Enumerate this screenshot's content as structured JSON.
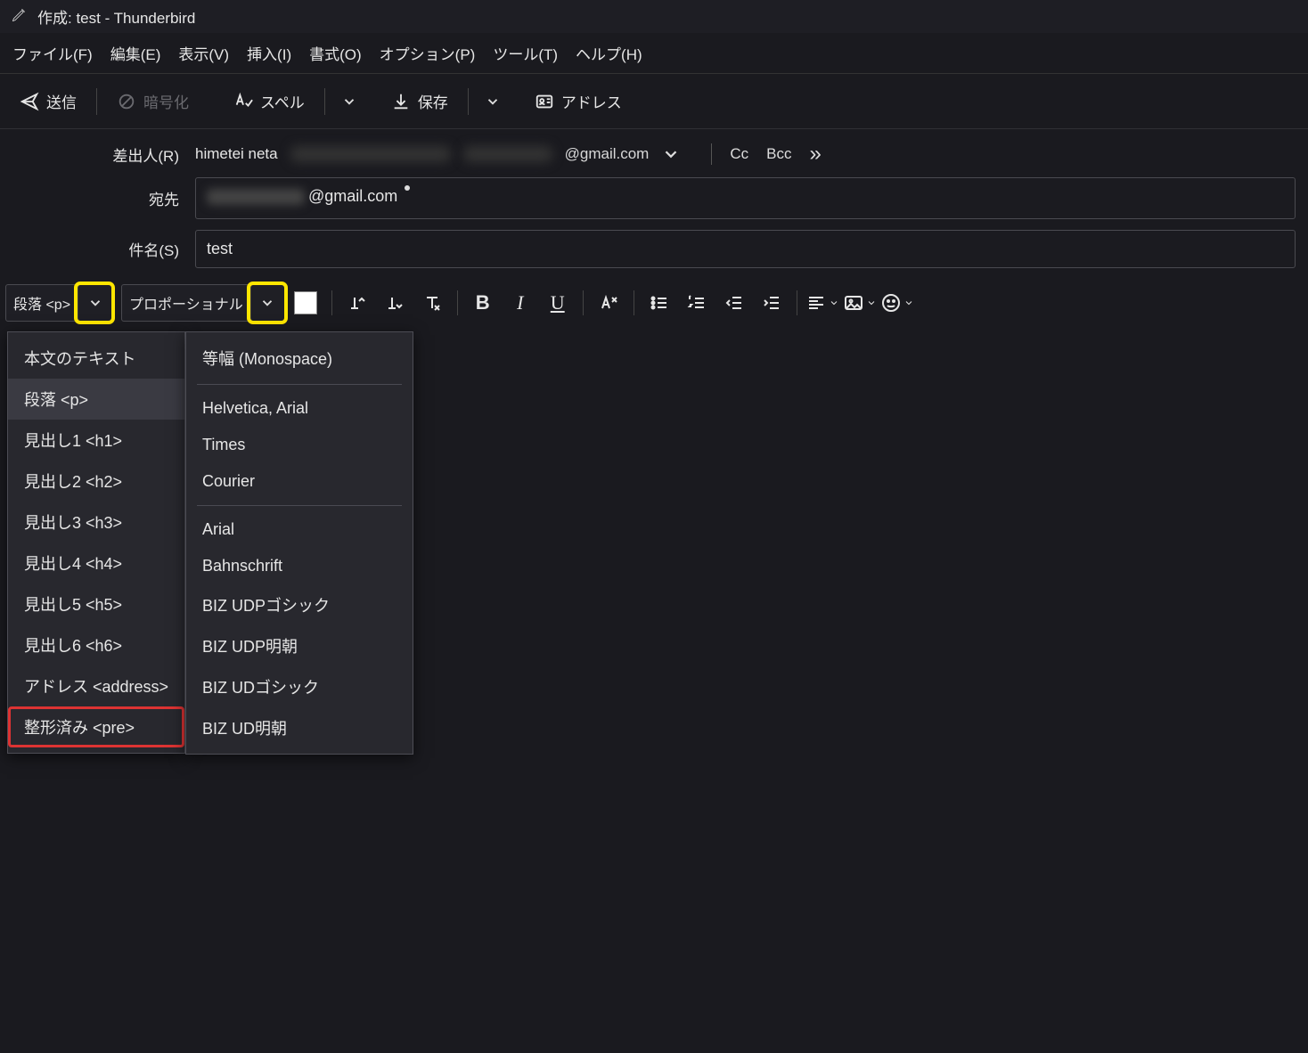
{
  "titlebar": {
    "title": "作成: test - Thunderbird"
  },
  "menubar": {
    "file": "ファイル(F)",
    "edit": "編集(E)",
    "view": "表示(V)",
    "insert": "挿入(I)",
    "format": "書式(O)",
    "options": "オプション(P)",
    "tools": "ツール(T)",
    "help": "ヘルプ(H)"
  },
  "toolbar": {
    "send": "送信",
    "encrypt": "暗号化",
    "spell": "スペル",
    "save": "保存",
    "address": "アドレス"
  },
  "fields": {
    "from_label": "差出人(R)",
    "from_name": "himetei neta",
    "from_email_suffix": "@gmail.com",
    "cc": "Cc",
    "bcc": "Bcc",
    "to_label": "宛先",
    "to_suffix": "@gmail.com",
    "subject_label": "件名(S)",
    "subject_value": "test"
  },
  "fmt": {
    "paragraph_label": "段落 <p>",
    "font_label": "プロポーショナル"
  },
  "dd_paragraph": [
    {
      "label": "本文のテキスト",
      "sel": false,
      "box": false
    },
    {
      "label": "段落 <p>",
      "sel": true,
      "box": false
    },
    {
      "label": "見出し1 <h1>",
      "sel": false,
      "box": false
    },
    {
      "label": "見出し2 <h2>",
      "sel": false,
      "box": false
    },
    {
      "label": "見出し3 <h3>",
      "sel": false,
      "box": false
    },
    {
      "label": "見出し4 <h4>",
      "sel": false,
      "box": false
    },
    {
      "label": "見出し5 <h5>",
      "sel": false,
      "box": false
    },
    {
      "label": "見出し6 <h6>",
      "sel": false,
      "box": false
    },
    {
      "label": "アドレス <address>",
      "sel": false,
      "box": false
    },
    {
      "label": "整形済み <pre>",
      "sel": false,
      "box": true
    }
  ],
  "dd_font_top": [
    "等幅 (Monospace)"
  ],
  "dd_font_mid": [
    "Helvetica, Arial",
    "Times",
    "Courier"
  ],
  "dd_font_bottom": [
    "Arial",
    "Bahnschrift",
    "BIZ UDPゴシック",
    "BIZ UDP明朝",
    "BIZ UDゴシック",
    "BIZ UD明朝"
  ]
}
